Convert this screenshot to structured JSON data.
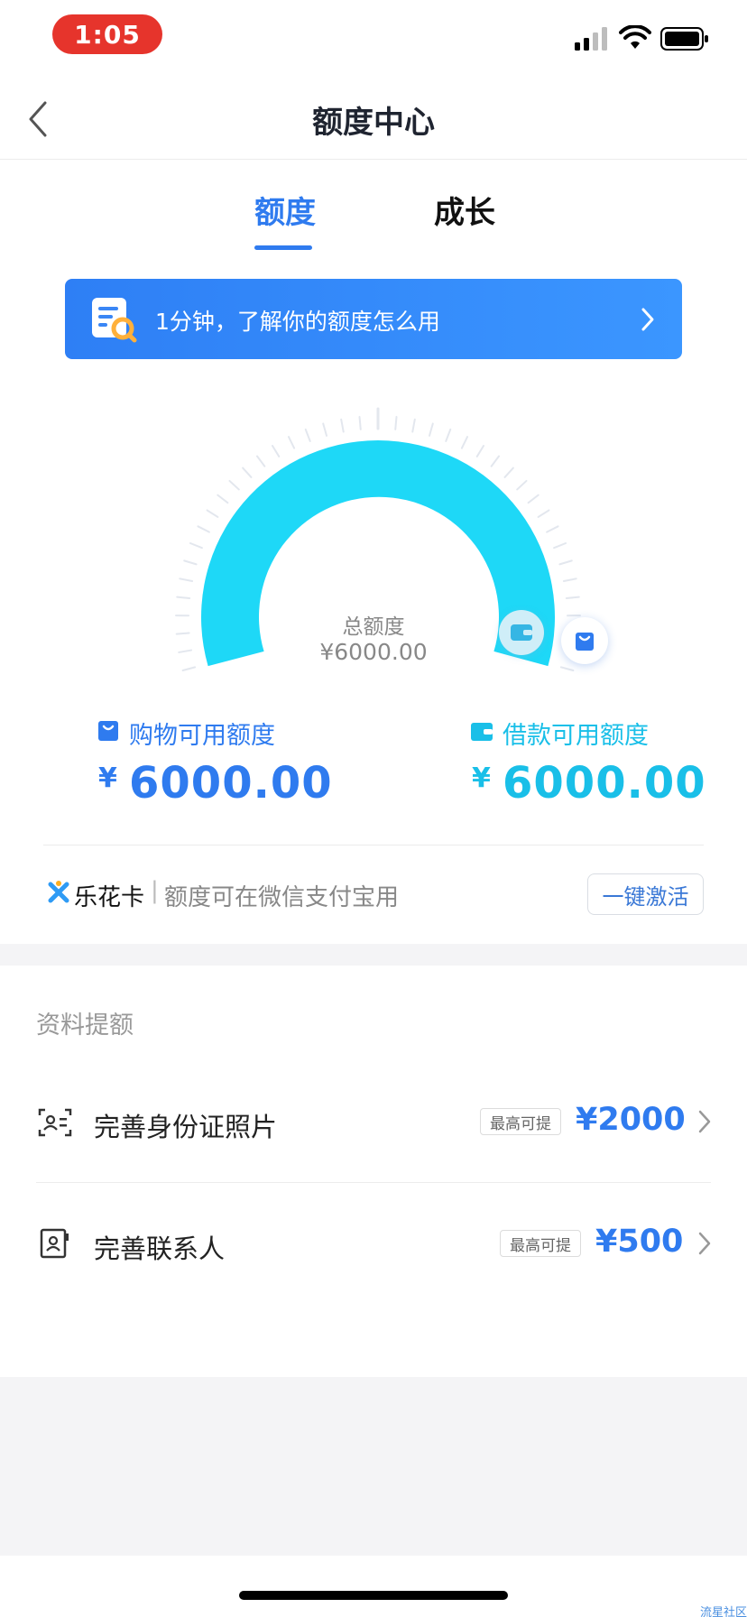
{
  "status_bar": {
    "time": "1:05"
  },
  "nav": {
    "title": "额度中心"
  },
  "tabs": [
    {
      "label": "额度",
      "active": true
    },
    {
      "label": "成长",
      "active": false
    }
  ],
  "banner": {
    "text": "1分钟，了解你的额度怎么用"
  },
  "gauge": {
    "total_label": "总额度",
    "total_value": "¥6000.00",
    "colors": {
      "arc": "#1ed8f7",
      "ticks": "#e3e7ee"
    }
  },
  "credits": {
    "shopping": {
      "label": "购物可用额度",
      "yen": "¥",
      "amount": "6000.00",
      "color": "#2f7bef"
    },
    "loan": {
      "label": "借款可用额度",
      "yen": "¥",
      "amount": "6000.00",
      "color": "#19bfe8"
    }
  },
  "lehua": {
    "brand": "乐花卡",
    "separator": "|",
    "description": "额度可在微信支付宝用",
    "button": "一键激活"
  },
  "boost": {
    "section_title": "资料提额",
    "items": [
      {
        "title": "完善身份证照片",
        "tag": "最高可提",
        "amount": "¥2000",
        "icon": "id-card-icon"
      },
      {
        "title": "完善联系人",
        "tag": "最高可提",
        "amount": "¥500",
        "icon": "contact-icon"
      }
    ]
  },
  "watermark": "流星社区"
}
